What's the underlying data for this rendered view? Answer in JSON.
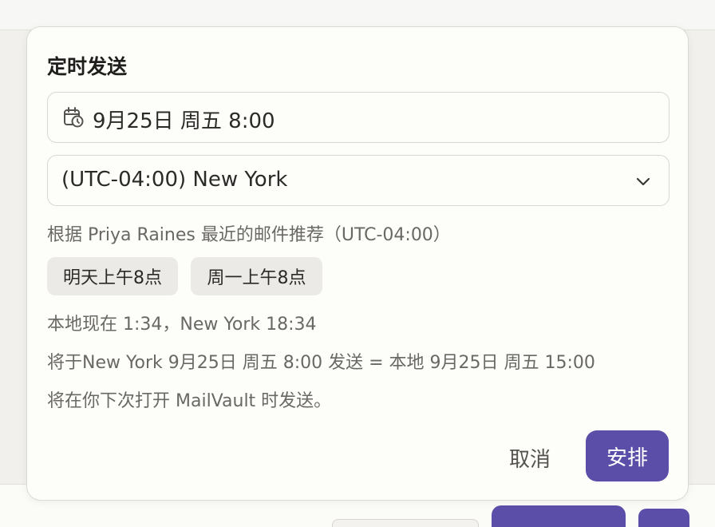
{
  "dialog": {
    "title": "定时发送",
    "date_value": "9月25日 周五 8:00",
    "timezone_value": "(UTC-04:00) New York",
    "recommendation": "根据 Priya Raines 最近的邮件推荐（UTC-04:00）",
    "quick_options": [
      "明天上午8点",
      "周一上午8点"
    ],
    "local_now": "本地现在 1:34，New York 18:34",
    "conversion": "将于New York 9月25日 周五 8:00 发送 = 本地 9月25日 周五 15:00",
    "send_note": "将在你下次打开 MailVault 时发送。",
    "cancel_label": "取消",
    "confirm_label": "安排"
  },
  "icons": {
    "date": "calendar-clock-icon",
    "timezone_dropdown": "chevron-down-icon"
  },
  "colors": {
    "accent": "#5b4ea8",
    "chip_bg": "#ebeae6",
    "muted_text": "#6a6864"
  }
}
